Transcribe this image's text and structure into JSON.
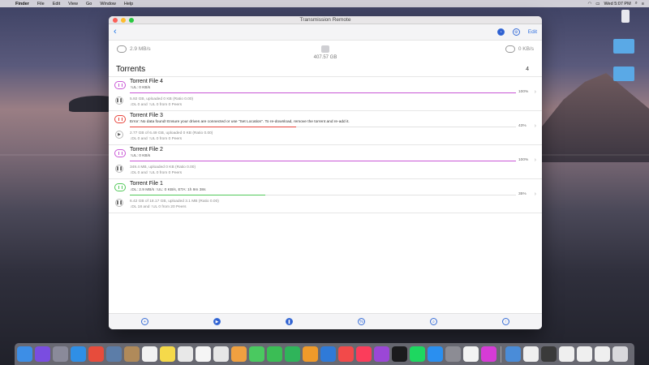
{
  "menubar": {
    "app": "Finder",
    "menus": [
      "File",
      "Edit",
      "View",
      "Go",
      "Window",
      "Help"
    ],
    "clock": "Wed 5:07 PM"
  },
  "desktop": {
    "icons": [
      {
        "name": "hard-drive-icon",
        "label": ""
      },
      {
        "name": "folder-icon",
        "label": ""
      },
      {
        "name": "folder-icon",
        "label": ""
      }
    ]
  },
  "window": {
    "title": "Transmission Remote",
    "toolbar": {
      "edit_label": "Edit"
    },
    "stats": {
      "download_speed": "2.9 MB/s",
      "disk_free": "407.57 GB",
      "upload_speed": "0 KB/s"
    },
    "section_title": "Torrents",
    "count": "4",
    "torrents": [
      {
        "name": "Torrent File 4",
        "status": "↑UL: 0 KB/s",
        "status_is_error": false,
        "progress": 100,
        "percent_label": "100%",
        "bar_color": "#c957d6",
        "icon_color": "#c957d6",
        "button_glyph": "❚❚",
        "info": "5.92 GB, uploaded 0 KB (Ratio 0.00)",
        "peers": "↓DL 0 and ↑UL 0 from 0 Peers"
      },
      {
        "name": "Torrent File 3",
        "status": "Error: No data found! Ensure your drives are connected or use \"Set Location\". To re-download, remove the torrent and re-add it.",
        "status_is_error": true,
        "progress": 43,
        "percent_label": "43%",
        "bar_color": "#e8453c",
        "icon_color": "#e8453c",
        "button_glyph": "▶",
        "info": "2.77 GB of 6.49 GB, uploaded 0 KB (Ratio 0.00)",
        "peers": "↓DL 0 and ↑UL 0 from 0 Peers"
      },
      {
        "name": "Torrent File 2",
        "status": "↑UL: 0 KB/s",
        "status_is_error": false,
        "progress": 100,
        "percent_label": "100%",
        "bar_color": "#c957d6",
        "icon_color": "#c957d6",
        "button_glyph": "❚❚",
        "info": "349.4 MB, uploaded 0 KB (Ratio 0.00)",
        "peers": "↓DL 0 and ↑UL 0 from 0 Peers"
      },
      {
        "name": "Torrent File 1",
        "status": "↓DL: 2.9 MB/s ↑UL: 0 KB/s, ETA: 1h 9m 38s",
        "status_is_error": false,
        "progress": 35,
        "percent_label": "35%",
        "bar_color": "#53c95a",
        "icon_color": "#53c95a",
        "button_glyph": "❚❚",
        "info": "6.42 GB of 18.17 GB, uploaded 3.1 MB (Ratio 0.00)",
        "peers": "↓DL 18 and ↑UL 0 from 20 Peers"
      }
    ],
    "bottom_icons": [
      "add-icon",
      "play-icon",
      "pause-icon",
      "link-icon",
      "search-icon",
      "upload-icon"
    ]
  },
  "dock": {
    "apps": [
      {
        "name": "finder-icon",
        "color": "#3d8ee6"
      },
      {
        "name": "siri-icon",
        "color": "#7a4de0"
      },
      {
        "name": "launchpad-icon",
        "color": "#8a8a9a"
      },
      {
        "name": "safari-icon",
        "color": "#2f8fe6"
      },
      {
        "name": "chrome-icon",
        "color": "#e74c3c"
      },
      {
        "name": "preview-icon",
        "color": "#5c7da8"
      },
      {
        "name": "contacts-icon",
        "color": "#b08a5a"
      },
      {
        "name": "calendar-icon",
        "color": "#f2f2f2"
      },
      {
        "name": "notes-icon",
        "color": "#f5d94a"
      },
      {
        "name": "textedit-icon",
        "color": "#e8e8e8"
      },
      {
        "name": "reminders-icon",
        "color": "#f5f5f5"
      },
      {
        "name": "keynote-icon",
        "color": "#e6e6e6"
      },
      {
        "name": "photos-icon",
        "color": "#f0a040"
      },
      {
        "name": "messages-icon",
        "color": "#4ac960"
      },
      {
        "name": "facetime-icon",
        "color": "#3bbd55"
      },
      {
        "name": "numbers-icon",
        "color": "#2fb45a"
      },
      {
        "name": "pages-icon",
        "color": "#f09a2a"
      },
      {
        "name": "xcode-icon",
        "color": "#2f7ad8"
      },
      {
        "name": "news-icon",
        "color": "#f24a4a"
      },
      {
        "name": "music-icon",
        "color": "#fb3d5b"
      },
      {
        "name": "podcasts-icon",
        "color": "#9b47d6"
      },
      {
        "name": "tv-icon",
        "color": "#1b1b1d"
      },
      {
        "name": "spotify-icon",
        "color": "#1ed760"
      },
      {
        "name": "app-store-icon",
        "color": "#2a8ff0"
      },
      {
        "name": "system-preferences-icon",
        "color": "#8c8c94"
      },
      {
        "name": "slack-icon",
        "color": "#f3f3f3"
      },
      {
        "name": "feedback-icon",
        "color": "#d63bd6"
      }
    ],
    "stack_items": [
      {
        "name": "downloads-folder-icon",
        "color": "#4a8cd8"
      },
      {
        "name": "doc-thumb-icon",
        "color": "#efefef"
      },
      {
        "name": "doc-thumb-icon",
        "color": "#3a3a3a"
      },
      {
        "name": "doc-thumb-icon",
        "color": "#efefef"
      },
      {
        "name": "doc-thumb-icon",
        "color": "#efefef"
      },
      {
        "name": "doc-thumb-icon",
        "color": "#efefef"
      },
      {
        "name": "trash-icon",
        "color": "#d8d8dc"
      }
    ]
  }
}
